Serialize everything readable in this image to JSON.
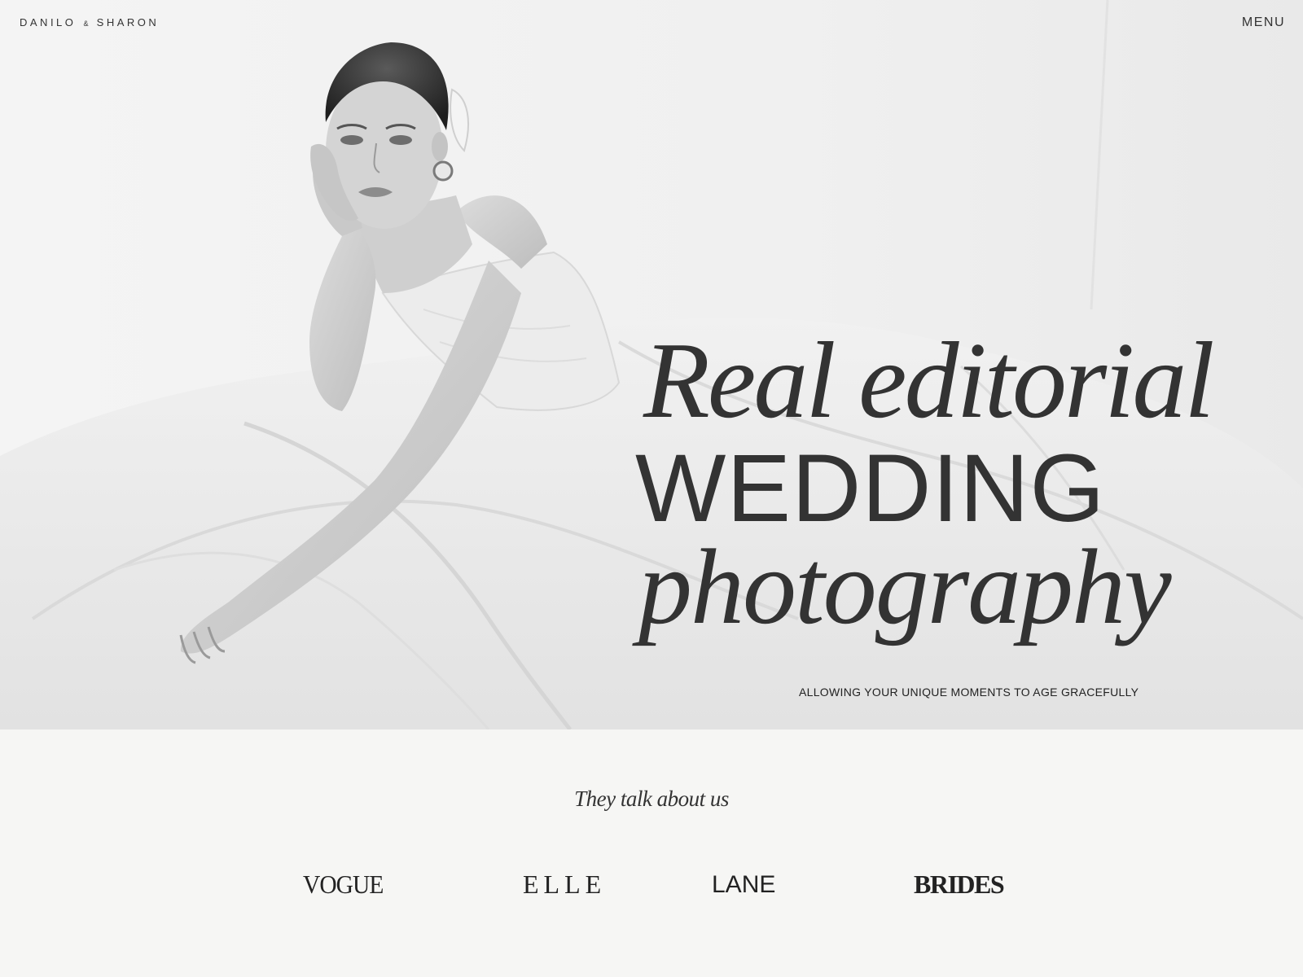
{
  "header": {
    "brand_left": "DANILO",
    "brand_amp": "&",
    "brand_right": "SHARON",
    "menu_label": "MENU"
  },
  "hero": {
    "headline_line1": "Real editorial",
    "headline_line2": "WEDDING",
    "headline_line3": "photography",
    "tagline": "ALLOWING YOUR UNIQUE MOMENTS TO AGE GRACEFULLY"
  },
  "press": {
    "title": "They talk about us",
    "logos": [
      "VOGUE",
      "ELLE",
      "LANE",
      "BRIDES"
    ]
  },
  "colors": {
    "page_bg": "#f6f6f4",
    "text": "#333333"
  }
}
